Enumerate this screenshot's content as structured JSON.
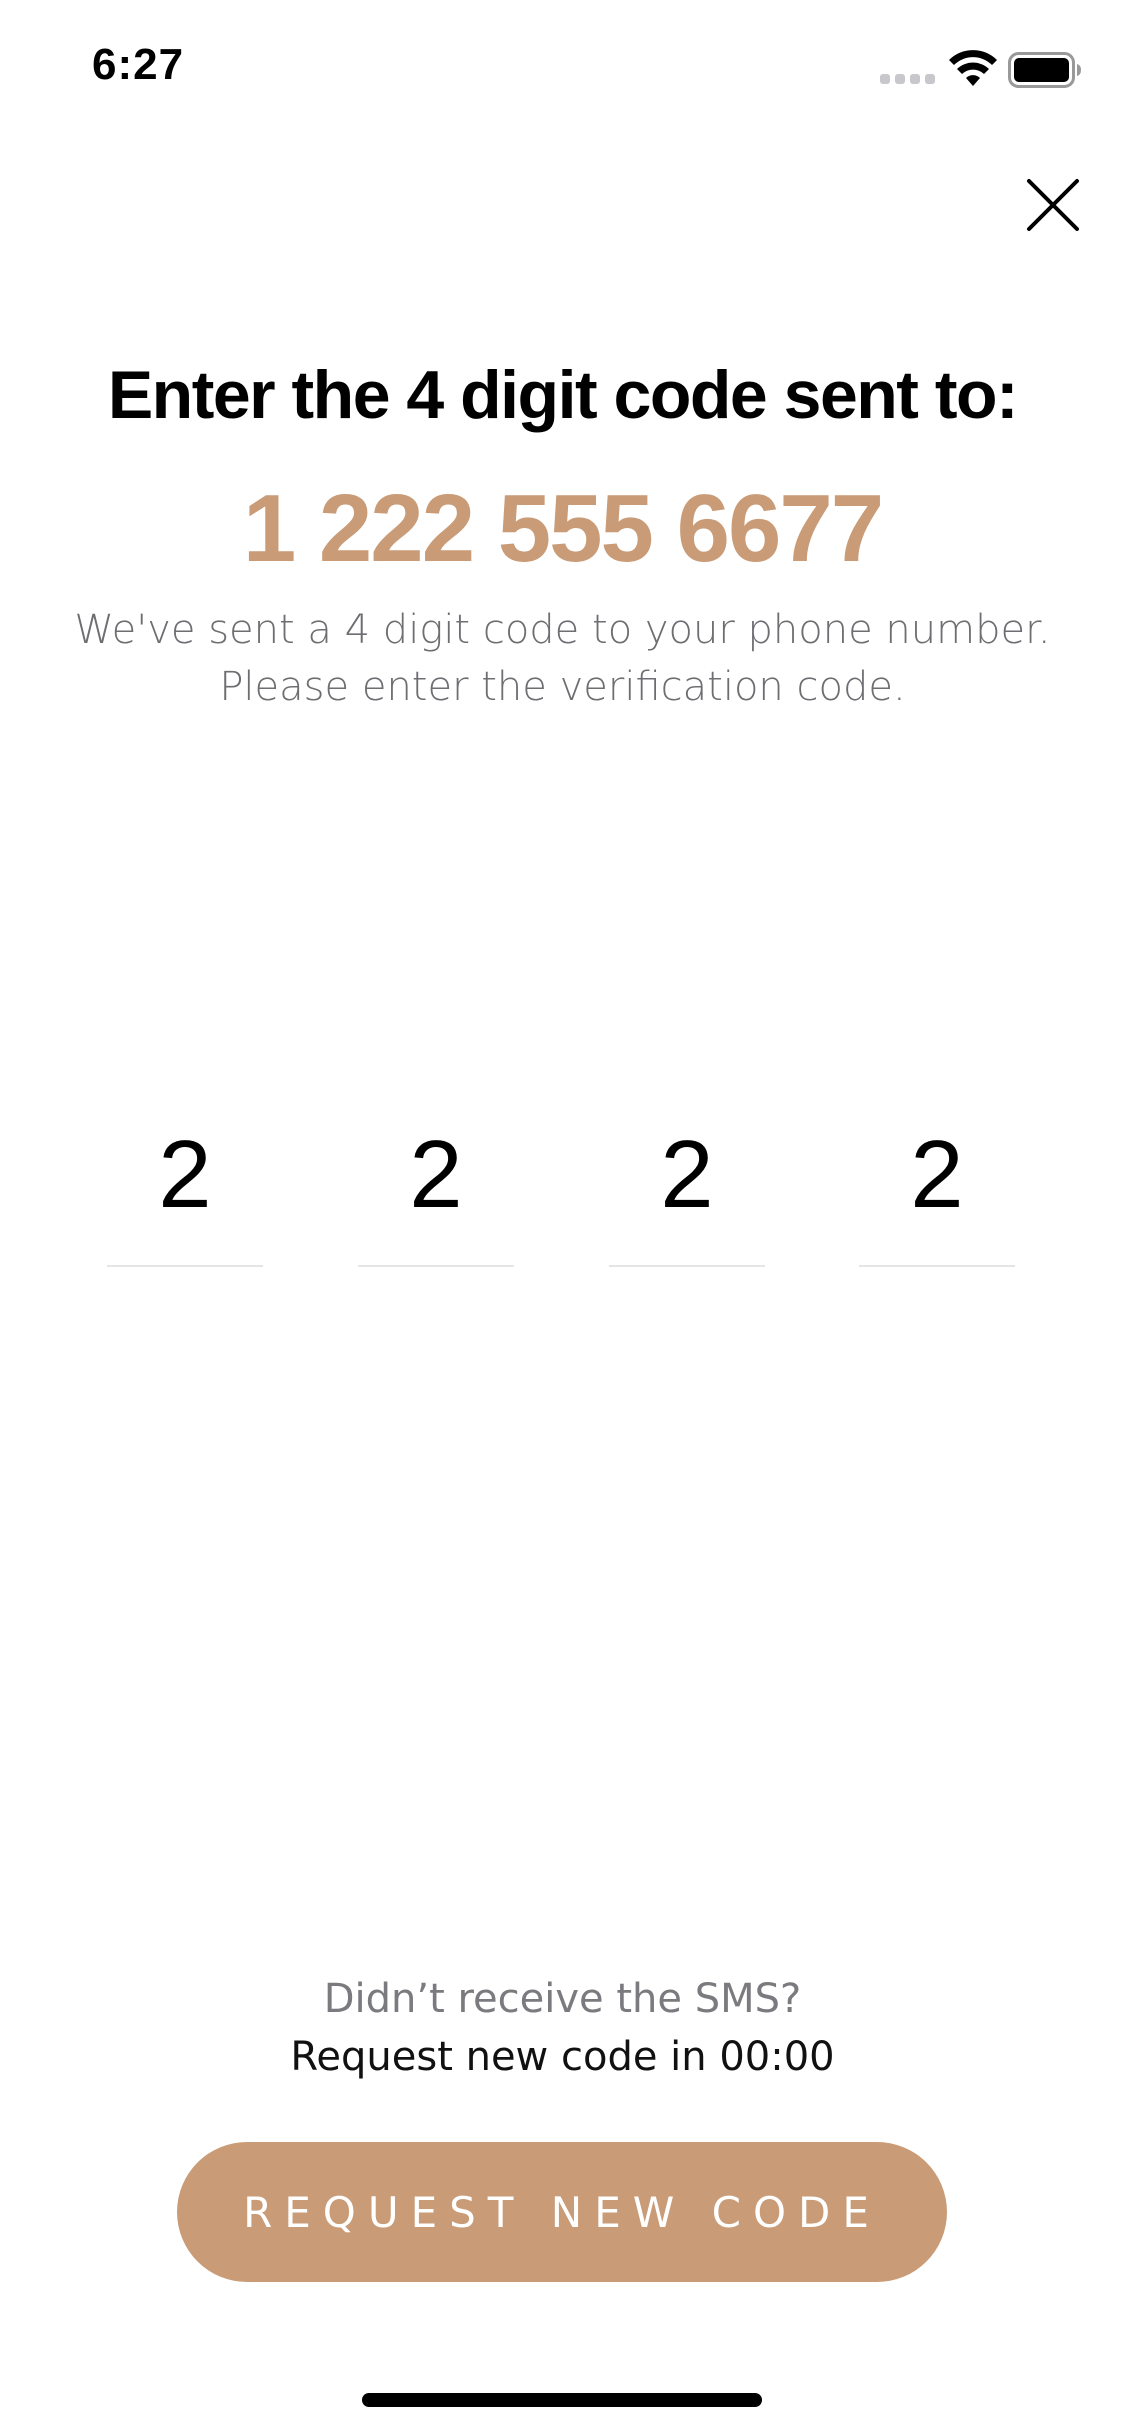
{
  "status_bar": {
    "time": "6:27",
    "signal_icon": "cellular-signal-icon",
    "wifi_icon": "wifi-icon",
    "battery_icon": "battery-icon"
  },
  "header": {
    "close_icon": "close-icon"
  },
  "main": {
    "headline": "Enter the 4 digit code sent to:",
    "phone_number": "1 222 555 6677",
    "description": "We've sent a 4 digit code to your phone number. Please enter the verification code.",
    "code_digits": [
      "2",
      "2",
      "2",
      "2"
    ]
  },
  "footer": {
    "sms_question": "Didn’t receive the SMS?",
    "countdown": "Request new code in 00:00",
    "request_button_label": "REQUEST NEW CODE"
  },
  "colors": {
    "accent": "#c99b76",
    "muted_text": "#6d6d72",
    "divider": "#e5e5e5"
  }
}
